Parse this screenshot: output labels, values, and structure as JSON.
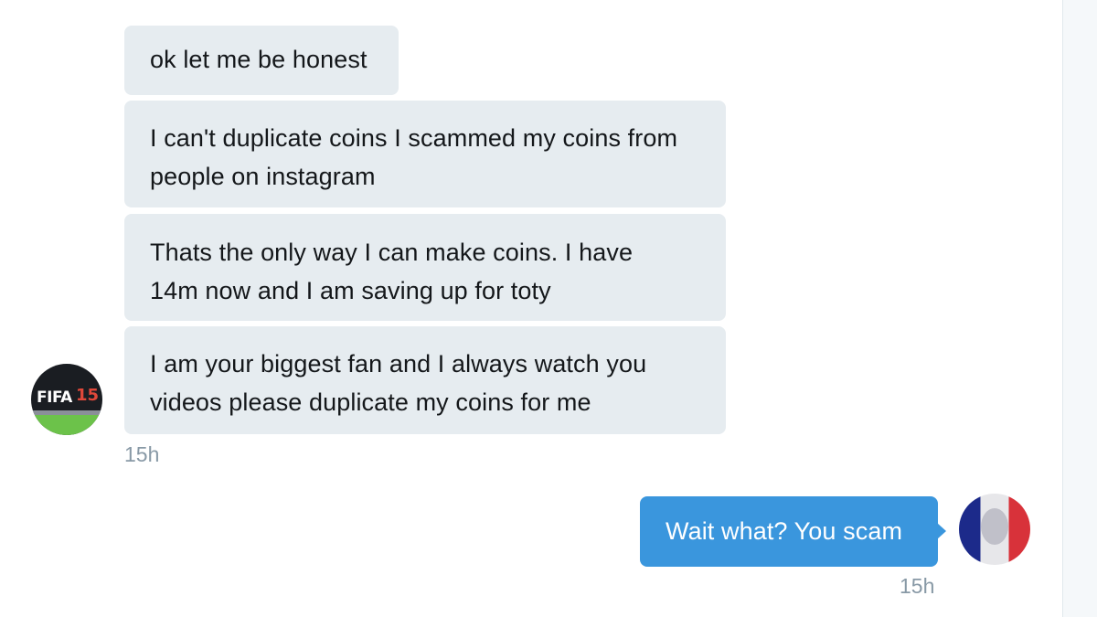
{
  "incoming_messages": [
    {
      "lines": [
        "ok let me be honest"
      ]
    },
    {
      "lines": [
        "I can't duplicate coins I scammed my coins from",
        "people on instagram"
      ]
    },
    {
      "lines": [
        "Thats the only way I can make coins. I have",
        "14m now and I am saving up for toty"
      ]
    },
    {
      "lines": [
        "I am your biggest fan and I always watch you",
        "videos please duplicate my coins for me"
      ]
    }
  ],
  "incoming_timestamp": "15h",
  "incoming_avatar": {
    "logo_text": "FIFA",
    "logo_number": "15",
    "icon": "fifa-15-logo-avatar"
  },
  "outgoing_message": {
    "text": "Wait what? You scam"
  },
  "outgoing_timestamp": "15h",
  "outgoing_avatar": {
    "icon": "french-flag-avatar"
  },
  "colors": {
    "incoming_bubble": "#e6ecf0",
    "outgoing_bubble": "#3a96dd",
    "timestamp": "#8899a6"
  }
}
